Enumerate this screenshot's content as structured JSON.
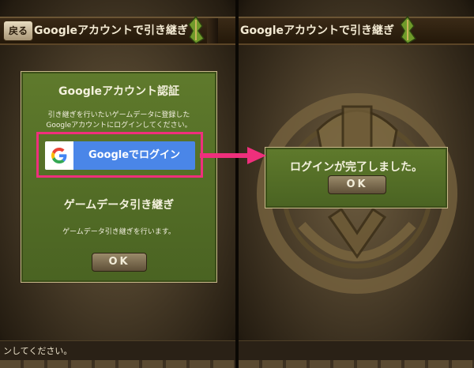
{
  "left_screen": {
    "back_label": "戻る",
    "title": "Googleアカウントで引き継ぎ",
    "dialog": {
      "heading": "Googleアカウント認証",
      "description_line1": "引き継ぎを行いたいゲームデータに登録した",
      "description_line2": "Googleアカウントにログインしてください。",
      "google_button_label": "Googleでログイン",
      "section_heading": "ゲームデータ引き継ぎ",
      "section_text": "ゲームデータ引き継ぎを行います。",
      "ok_label": "OK"
    },
    "footer_text": "ンしてください。"
  },
  "right_screen": {
    "title": "Googleアカウントで引き継ぎ",
    "dialog": {
      "message": "ログインが完了しました。",
      "ok_label": "OK"
    }
  },
  "colors": {
    "highlight": "#ef2f7c",
    "dialog_green": "#5a7429",
    "google_blue": "#4a86e8"
  },
  "icons": [
    "google-g-icon",
    "leaf-emblem-icon",
    "arrow-right-icon",
    "dragon-sigil"
  ]
}
